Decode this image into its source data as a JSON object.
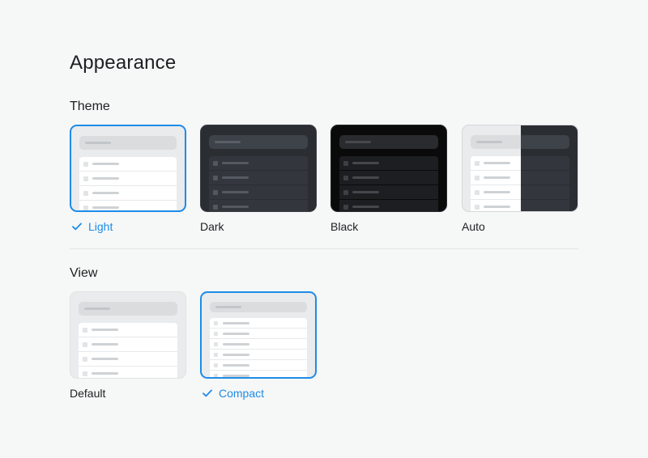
{
  "page": {
    "title": "Appearance"
  },
  "theme": {
    "title": "Theme",
    "options": [
      {
        "label": "Light",
        "selected": true
      },
      {
        "label": "Dark",
        "selected": false
      },
      {
        "label": "Black",
        "selected": false
      },
      {
        "label": "Auto",
        "selected": false
      }
    ]
  },
  "view": {
    "title": "View",
    "options": [
      {
        "label": "Default",
        "selected": false
      },
      {
        "label": "Compact",
        "selected": true
      }
    ]
  },
  "colors": {
    "accent": "#1d8ce8",
    "background": "#f6f7f7",
    "text": "#1d1f22"
  },
  "icons": {
    "selected": "checkmark-icon"
  }
}
